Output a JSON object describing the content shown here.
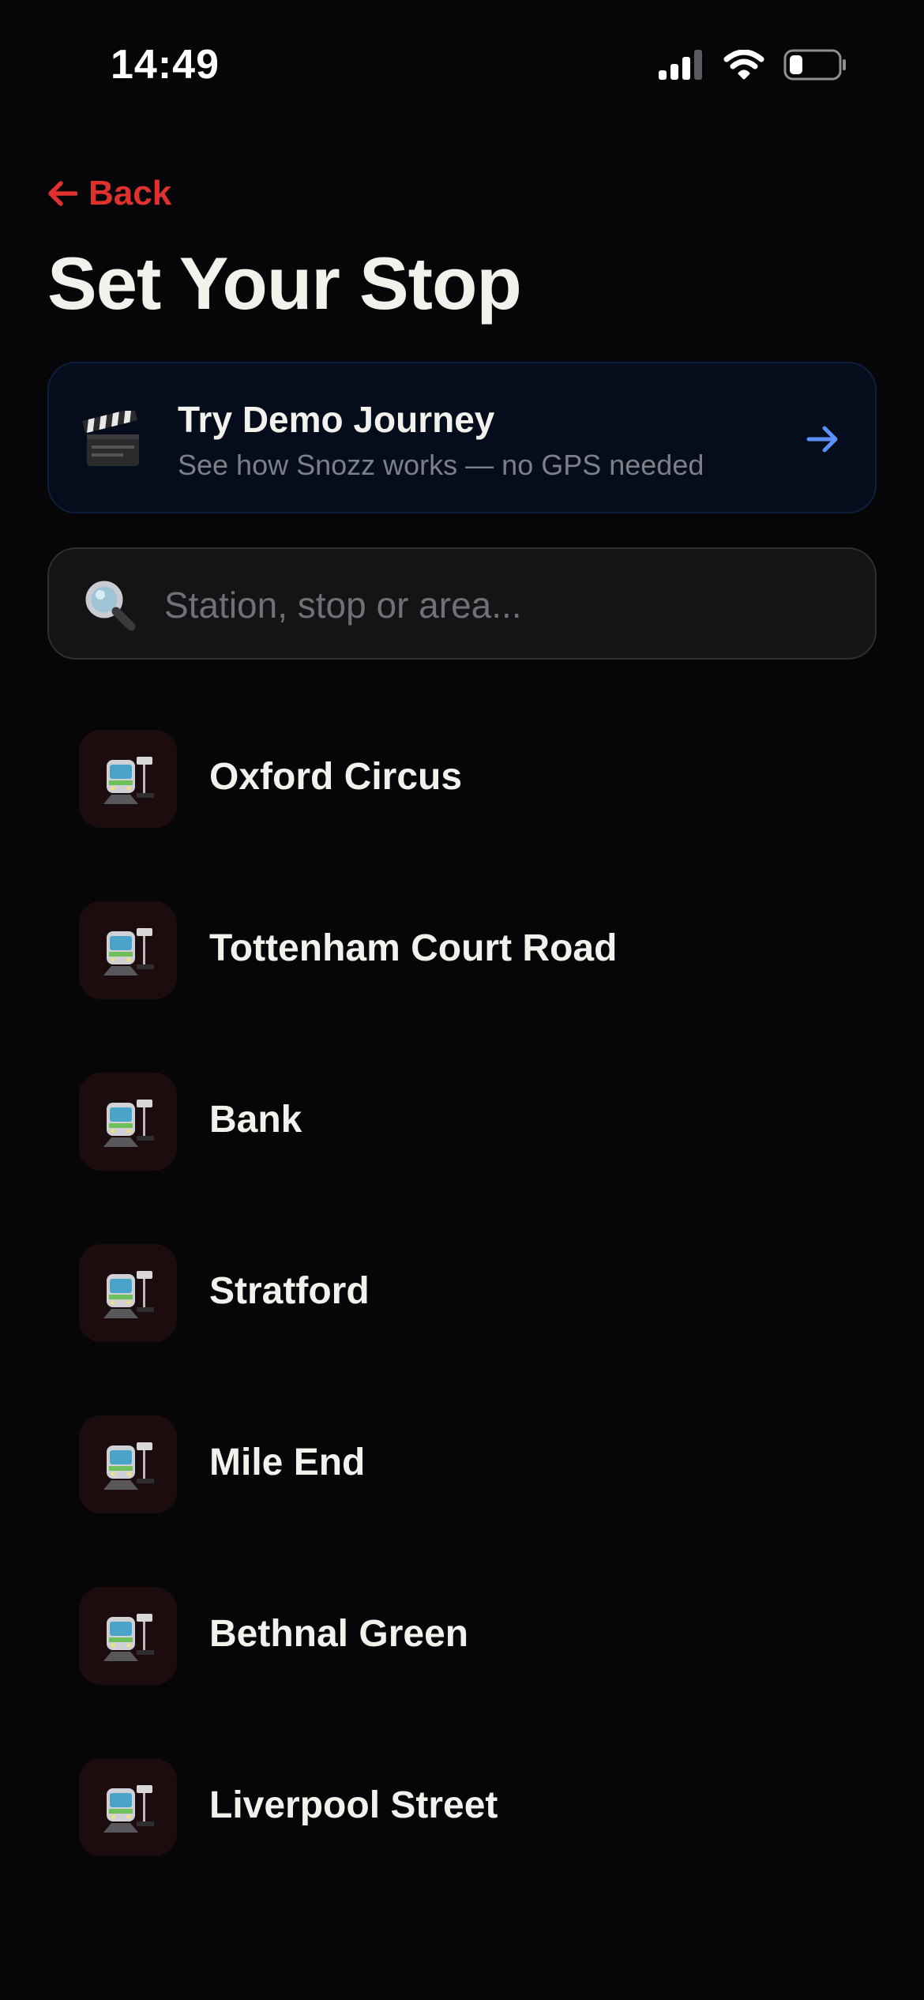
{
  "status_bar": {
    "time": "14:49",
    "icons": [
      "cellular-signal-icon",
      "wifi-icon",
      "battery-icon"
    ]
  },
  "nav": {
    "back_label": "Back",
    "back_icon": "arrow-left-icon"
  },
  "header": {
    "title": "Set Your Stop"
  },
  "demo_card": {
    "icon": "clapper-board-icon",
    "title": "Try Demo Journey",
    "subtitle": "See how Snozz works — no GPS needed",
    "arrow_icon": "arrow-right-icon"
  },
  "search": {
    "icon": "magnifying-glass-icon",
    "placeholder": "Station, stop or area...",
    "value": ""
  },
  "stops": [
    {
      "name": "Oxford Circus",
      "icon": "tram-icon"
    },
    {
      "name": "Tottenham Court Road",
      "icon": "tram-icon"
    },
    {
      "name": "Bank",
      "icon": "tram-icon"
    },
    {
      "name": "Stratford",
      "icon": "tram-icon"
    },
    {
      "name": "Mile End",
      "icon": "tram-icon"
    },
    {
      "name": "Bethnal Green",
      "icon": "tram-icon"
    },
    {
      "name": "Liverpool Street",
      "icon": "tram-icon"
    }
  ],
  "colors": {
    "background": "#060608",
    "accent_red": "#e0312f",
    "accent_blue": "#5b8ff9",
    "text_primary": "#f3f1ec",
    "text_secondary": "#7d7f86",
    "card_background": "#050c1c",
    "search_background": "#141416",
    "stop_icon_background": "#1d0c0d"
  }
}
